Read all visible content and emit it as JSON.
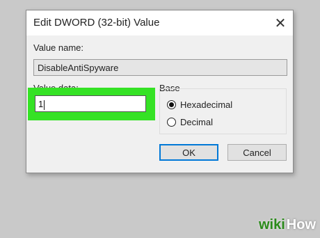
{
  "dialog": {
    "title": "Edit DWORD (32-bit) Value",
    "close_icon": "close-icon",
    "value_name_label": "Value name:",
    "value_name": "DisableAntiSpyware",
    "value_data_label": "Value data:",
    "value_data": "1",
    "base": {
      "label": "Base",
      "options": [
        {
          "label": "Hexadecimal",
          "selected": true
        },
        {
          "label": "Decimal",
          "selected": false
        }
      ]
    },
    "buttons": {
      "ok": "OK",
      "cancel": "Cancel"
    }
  },
  "highlight_color": "#35e225",
  "accent_color": "#0078d7",
  "watermark": {
    "part1": "wiki",
    "part2": "How"
  }
}
